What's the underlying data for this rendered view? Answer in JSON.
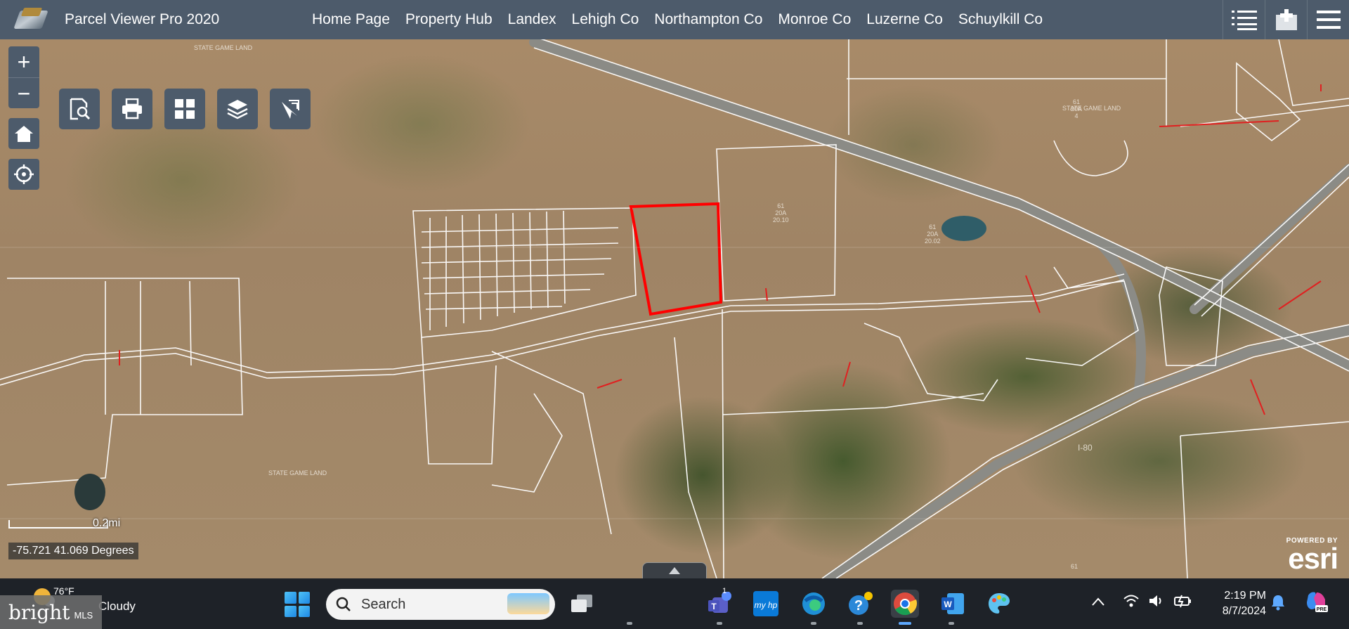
{
  "app": {
    "title": "Parcel Viewer Pro 2020",
    "nav": [
      "Home Page",
      "Property Hub",
      "Landex",
      "Lehigh Co",
      "Northampton Co",
      "Monroe Co",
      "Luzerne Co",
      "Schuylkill Co"
    ]
  },
  "map": {
    "scale_label": "0.2mi",
    "coordinates": "-75.721 41.069 Degrees",
    "attribution_top": "POWERED BY",
    "attribution_brand": "esri",
    "labels": {
      "game_land_1": "STATE GAME LAND",
      "game_land_2": "STATE GAME LAND",
      "game_land_3": "STATE GAME LAND",
      "parcel_61_20A_4": "61\n20A\n4",
      "parcel_61_20A_2002": "61\n20A\n20.02",
      "parcel_61_20A_2010": "61\n20A\n20.10",
      "road_i80": "I-80",
      "parcel_61": "61"
    },
    "highlight_color": "#ff0000"
  },
  "taskbar": {
    "weather_temp": "76°F",
    "weather_cond": "Cloudy",
    "search_placeholder": "Search",
    "teams_badge": "1",
    "time": "2:19 PM",
    "date": "8/7/2024"
  },
  "watermark": {
    "brand": "bright",
    "suffix": "MLS"
  }
}
